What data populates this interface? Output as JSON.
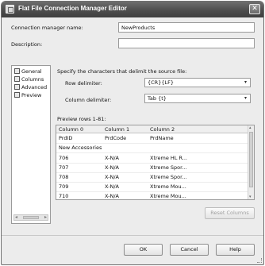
{
  "window": {
    "title": "Flat File Connection Manager Editor",
    "close_glyph": "✕"
  },
  "form": {
    "connection_manager_name_label": "Connection manager name:",
    "connection_manager_name_value": "NewProducts",
    "description_label": "Description:",
    "description_value": ""
  },
  "sidebar": {
    "items": [
      {
        "label": "General",
        "icon": "general-icon"
      },
      {
        "label": "Columns",
        "icon": "columns-icon"
      },
      {
        "label": "Advanced",
        "icon": "advanced-icon"
      },
      {
        "label": "Preview",
        "icon": "preview-icon"
      }
    ],
    "scroll_left_glyph": "◂",
    "scroll_right_glyph": "▸"
  },
  "delimiters": {
    "instruction": "Specify the characters that delimit the source file:",
    "row_label": "Row delimiter:",
    "row_value": "{CR}{LF}",
    "column_label": "Column delimiter:",
    "column_value": "Tab {t}",
    "dropdown_glyph": "▾"
  },
  "preview": {
    "label": "Preview rows 1-81:",
    "columns": [
      "Column 0",
      "Column 1",
      "Column 2"
    ],
    "rows": [
      [
        "PrdID",
        "PrdCode",
        "PrdName"
      ],
      [
        "New Accessories",
        "",
        ""
      ],
      [
        "706",
        "X-N/A",
        "Xtreme HL R..."
      ],
      [
        "707",
        "X-N/A",
        "Xtreme Spor..."
      ],
      [
        "708",
        "X-N/A",
        "Xtreme Spor..."
      ],
      [
        "709",
        "X-N/A",
        "Xtreme Mou..."
      ],
      [
        "710",
        "X-N/A",
        "Xtreme Mou..."
      ]
    ],
    "scroll_up_glyph": "▴",
    "scroll_down_glyph": "▾"
  },
  "buttons": {
    "reset_columns": "Reset Columns",
    "ok": "OK",
    "cancel": "Cancel",
    "help": "Help"
  }
}
